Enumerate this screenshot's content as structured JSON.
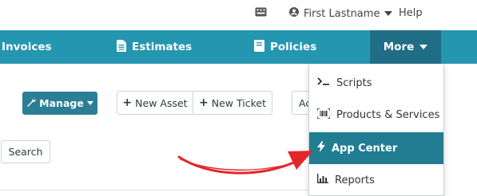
{
  "topbar": {
    "user_name": "First Lastname",
    "help_label": "Help"
  },
  "nav": {
    "invoices_label": "Invoices",
    "estimates_label": "Estimates",
    "policies_label": "Policies",
    "more_label": "More"
  },
  "toolbar": {
    "manage_label": "Manage",
    "new_asset_label": "New Asset",
    "new_ticket_label": "New Ticket",
    "partial_button_label": "Ac",
    "search_label": "Search"
  },
  "more_menu": {
    "items": [
      {
        "label": "Scripts",
        "icon": "terminal-icon"
      },
      {
        "label": "Products & Services",
        "icon": "barcode-icon"
      },
      {
        "label": "App Center",
        "icon": "bolt-icon",
        "active": true
      },
      {
        "label": "Reports",
        "icon": "bar-chart-icon"
      }
    ]
  },
  "colors": {
    "nav_bg": "#2596b0",
    "nav_active_bg": "#1f6e86",
    "manage_bg": "#2a7f95",
    "menu_active_bg": "#217d92",
    "annotation_arrow": "#e3262b"
  }
}
